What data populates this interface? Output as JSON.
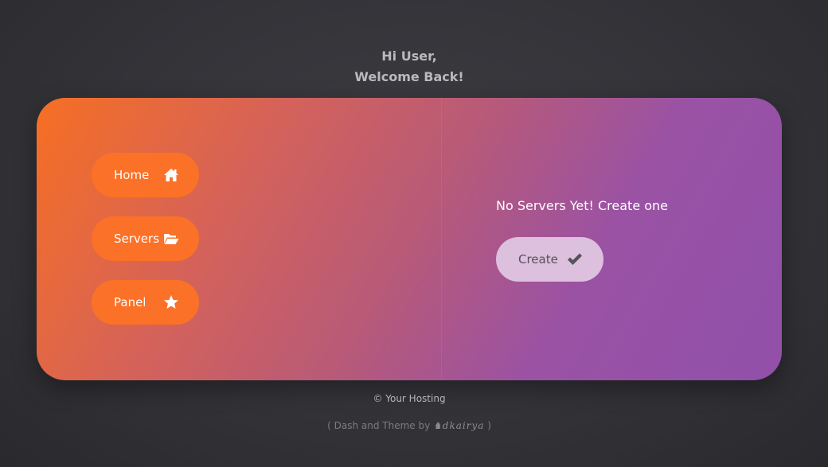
{
  "header": {
    "greeting_line1": "Hi User,",
    "greeting_line2": "Welcome Back!"
  },
  "nav": {
    "items": [
      {
        "label": "Home",
        "icon": "home-icon"
      },
      {
        "label": "Servers",
        "icon": "folder-open-icon"
      },
      {
        "label": "Panel",
        "icon": "star-icon"
      }
    ]
  },
  "main": {
    "empty_message": "No Servers Yet! Create one",
    "create_label": "Create",
    "create_icon": "check-icon"
  },
  "footer": {
    "copyright": "© Your Hosting",
    "credit_prefix": "( Dash and Theme by ",
    "credit_author": "♞dkairya",
    "credit_suffix": " )"
  },
  "colors": {
    "background": "#333338",
    "accent_orange": "#fb7127",
    "accent_purple": "#9150aa",
    "create_button": "#dcc0dd"
  }
}
